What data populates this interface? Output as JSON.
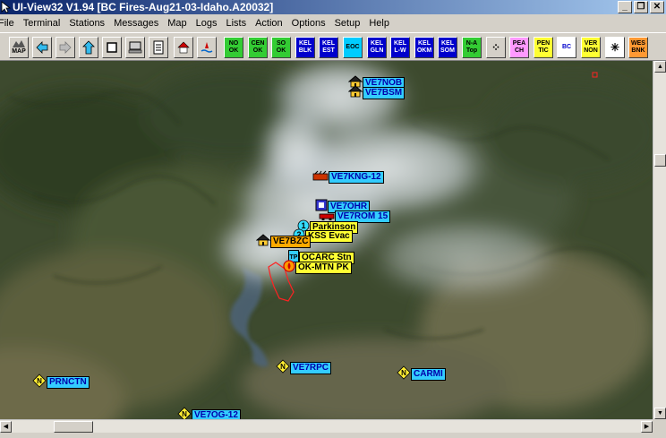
{
  "window": {
    "title": "UI-View32 V1.94 [BC Fires-Aug21-03-Idaho.A20032]",
    "controls": [
      "_",
      "❐",
      "✕"
    ]
  },
  "menu": [
    "File",
    "Terminal",
    "Stations",
    "Messages",
    "Map",
    "Logs",
    "Lists",
    "Action",
    "Options",
    "Setup",
    "Help"
  ],
  "toolbar": {
    "text_buttons": [
      {
        "label": "NO\nOK",
        "bg": "#33cc33",
        "fg": "#000000"
      },
      {
        "label": "CEN\nOK",
        "bg": "#33cc33",
        "fg": "#000000"
      },
      {
        "label": "SO\nOK",
        "bg": "#33cc33",
        "fg": "#000000"
      },
      {
        "label": "KEL\nBLK",
        "bg": "#0000cc",
        "fg": "#ffffff"
      },
      {
        "label": "KEL\nEST",
        "bg": "#0000cc",
        "fg": "#ffffff"
      },
      {
        "label": "EOC",
        "bg": "#00ccff",
        "fg": "#000000"
      },
      {
        "label": "KEL\nGLN",
        "bg": "#0000cc",
        "fg": "#ffffff"
      },
      {
        "label": "KEL\nL-W",
        "bg": "#0000cc",
        "fg": "#ffffff"
      },
      {
        "label": "KEL\nOKM",
        "bg": "#0000cc",
        "fg": "#ffffff"
      },
      {
        "label": "KEL\nSOM",
        "bg": "#0000cc",
        "fg": "#ffffff"
      },
      {
        "label": "N-A\nTop",
        "bg": "#33cc33",
        "fg": "#000000"
      },
      {
        "label": "",
        "bg": "#d4d0c8",
        "fg": "#000000"
      },
      {
        "label": "PEA\nCH",
        "bg": "#ff99ff",
        "fg": "#000000"
      },
      {
        "label": "PEN\nTIC",
        "bg": "#ffff33",
        "fg": "#000000"
      },
      {
        "label": "BC",
        "bg": "#ffffff",
        "fg": "#0000cc"
      },
      {
        "label": "VER\nNON",
        "bg": "#ffff33",
        "fg": "#000000"
      },
      {
        "label": "",
        "bg": "#ffffff",
        "fg": "#000000"
      },
      {
        "label": "WES\nBNK",
        "bg": "#ff9933",
        "fg": "#000000"
      }
    ],
    "map_button_label": "MAP"
  },
  "stations": [
    {
      "id": "ve7nob",
      "label": "VE7NOB",
      "color": "cyan",
      "icon": "house-icon"
    },
    {
      "id": "ve7bsm",
      "label": "VE7BSM",
      "color": "cyan",
      "icon": "house-icon"
    },
    {
      "id": "ve7kng",
      "label": "VE7KNG-12",
      "color": "cyan",
      "icon": "tower-icon"
    },
    {
      "id": "ve7ohr",
      "label": "VE7OHR",
      "color": "cyan",
      "icon": "digipeater-icon"
    },
    {
      "id": "ve7rom",
      "label": "VE7ROM 15",
      "color": "cyan",
      "icon": "car-icon"
    },
    {
      "id": "parkinson",
      "label": "Parkinson",
      "color": "yellow",
      "icon": "number-1-icon"
    },
    {
      "id": "kss-evac",
      "label": "KSS Evac",
      "color": "yellow",
      "icon": "number-2-icon"
    },
    {
      "id": "ve7bzc",
      "label": "VE7BZC",
      "color": "orange",
      "icon": "house-icon"
    },
    {
      "id": "ocarc",
      "label": "OCARC Stn",
      "color": "yellow",
      "icon": "tp-icon"
    },
    {
      "id": "okmtn",
      "label": "OK-MTN PK",
      "color": "yellow",
      "icon": "fire-icon"
    },
    {
      "id": "ve7rpc",
      "label": "VE7RPC",
      "color": "cyan",
      "icon": "n-diamond-icon"
    },
    {
      "id": "carmi",
      "label": "CARMI",
      "color": "cyan",
      "icon": "n-diamond-icon"
    },
    {
      "id": "prnctn",
      "label": "PRNCTN",
      "color": "cyan",
      "icon": "n-diamond-icon"
    },
    {
      "id": "ve7og",
      "label": "VE7OG-12",
      "color": "cyan",
      "icon": "n-diamond-icon"
    }
  ]
}
